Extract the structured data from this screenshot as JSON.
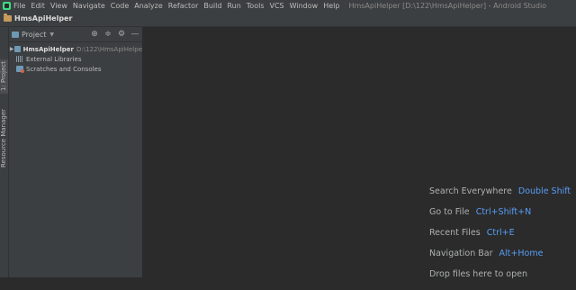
{
  "menubar": {
    "items": [
      "File",
      "Edit",
      "View",
      "Navigate",
      "Code",
      "Analyze",
      "Refactor",
      "Build",
      "Run",
      "Tools",
      "VCS",
      "Window",
      "Help"
    ],
    "window_title": "HmsApiHelper [D:\\122\\HmsApiHelper] - Android Studio"
  },
  "navbar": {
    "project_name": "HmsApiHelper"
  },
  "left_strip": {
    "project_tab": "1: Project",
    "resource_manager_tab": "Resource Manager"
  },
  "project_panel": {
    "title": "Project",
    "tree": {
      "root": {
        "label": "HmsApiHelper",
        "path": "D:\\122\\HmsApiHelpe"
      },
      "items": [
        "External Libraries",
        "Scratches and Consoles"
      ]
    }
  },
  "editor": {
    "hints": [
      {
        "action": "Search Everywhere",
        "key": "Double Shift"
      },
      {
        "action": "Go to File",
        "key": "Ctrl+Shift+N"
      },
      {
        "action": "Recent Files",
        "key": "Ctrl+E"
      },
      {
        "action": "Navigation Bar",
        "key": "Alt+Home"
      },
      {
        "action": "Drop files here to open",
        "key": ""
      }
    ]
  },
  "colors": {
    "background": "#2b2b2b",
    "panel": "#3c3f41",
    "shortcut": "#589df6"
  }
}
